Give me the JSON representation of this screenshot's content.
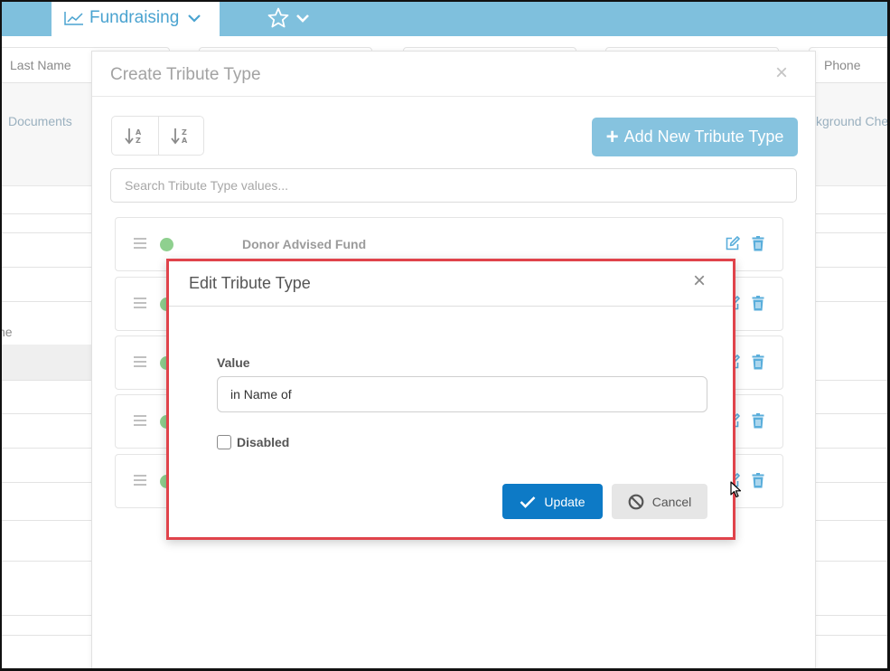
{
  "nav": {
    "module_label": "Fundraising",
    "favorite_icon": "star-icon"
  },
  "background": {
    "columns": [
      "Last Name",
      "Phone",
      "Documents",
      "kground Che",
      "ne"
    ]
  },
  "create_modal": {
    "title": "Create Tribute Type",
    "close": "×",
    "sort_asc_icon": "sort-alpha-asc-icon",
    "sort_desc_icon": "sort-alpha-desc-icon",
    "add_button_label": "Add New Tribute Type",
    "add_button_plus": "+",
    "search_placeholder": "Search Tribute Type values...",
    "items": [
      {
        "label": "Donor Advised Fund",
        "active": true
      },
      {
        "label": "",
        "active": true
      },
      {
        "label": "",
        "active": true
      },
      {
        "label": "",
        "active": true
      },
      {
        "label": "",
        "active": true
      }
    ]
  },
  "edit_dialog": {
    "title": "Edit Tribute Type",
    "close": "×",
    "value_label": "Value",
    "value": "in Name of",
    "disabled_label": "Disabled",
    "disabled_checked": false,
    "update_label": "Update",
    "cancel_label": "Cancel"
  },
  "colors": {
    "topbar": "#7fc0dd",
    "accent": "#0d7ac6",
    "add_button": "#86c3df",
    "active_dot": "#8fd08f",
    "highlight_border": "#e0434b"
  }
}
